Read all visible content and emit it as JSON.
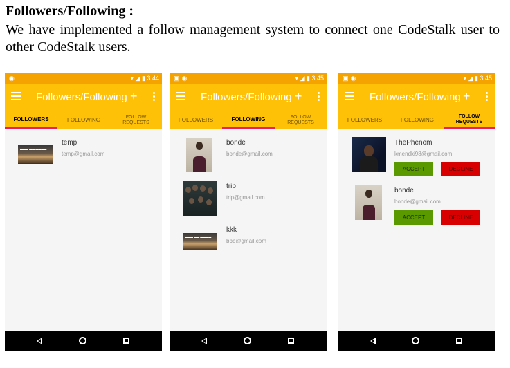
{
  "document": {
    "heading": "Followers/Following :",
    "paragraph": "We have implemented a follow management system to connect one CodeStalk user to other CodeStalk users."
  },
  "colors": {
    "status_bar": "#f4a300",
    "app_bar": "#ffc107",
    "tab_indicator": "#e91e63",
    "accept": "#5a9a00",
    "decline": "#d80000"
  },
  "icons": [
    "menu-icon",
    "plus-icon",
    "more-vert-icon",
    "wifi-icon",
    "signal-icon",
    "battery-icon",
    "back-icon",
    "home-icon",
    "recent-apps-icon"
  ],
  "phones": [
    {
      "time": "3:44",
      "title": "Followers/Following",
      "tabs": [
        "FOLLOWERS",
        "FOLLOWING",
        "FOLLOW REQUESTS"
      ],
      "active_tab": 0,
      "rows": [
        {
          "name": "temp",
          "email": "temp@gmail.com"
        }
      ]
    },
    {
      "time": "3:45",
      "title": "Followers/Following",
      "tabs": [
        "FOLLOWERS",
        "FOLLOWING",
        "FOLLOW REQUESTS"
      ],
      "active_tab": 1,
      "rows": [
        {
          "name": "bonde",
          "email": "bonde@gmail.com"
        },
        {
          "name": "trip",
          "email": "trip@gmail.com"
        },
        {
          "name": "kkk",
          "email": "bbb@gmail.com"
        }
      ]
    },
    {
      "time": "3:45",
      "title": "Followers/Following",
      "tabs": [
        "FOLLOWERS",
        "FOLLOWING",
        "FOLLOW REQUESTS"
      ],
      "active_tab": 2,
      "rows": [
        {
          "name": "ThePhenom",
          "email": "kmendki98@gmail.com",
          "accept": "ACCEPT",
          "decline": "DECLINE"
        },
        {
          "name": "bonde",
          "email": "bonde@gmail.com",
          "accept": "ACCEPT",
          "decline": "DECLINE"
        }
      ]
    }
  ]
}
